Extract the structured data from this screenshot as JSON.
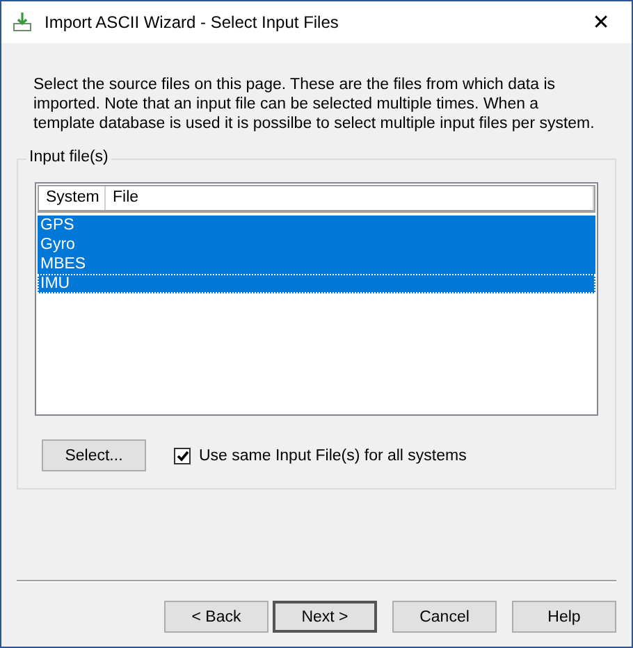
{
  "window": {
    "title": "Import ASCII Wizard - Select Input Files",
    "close": "✕"
  },
  "description": "Select the source files on this page. These are the files from which data is imported. Note that an input file can be selected multiple times. When a template database is used it is possilbe to select multiple input files per system.",
  "group": {
    "title": "Input file(s)",
    "table": {
      "columns": [
        "System",
        "File"
      ],
      "rows": [
        {
          "system": "GPS",
          "selected": true,
          "focused": false
        },
        {
          "system": "Gyro",
          "selected": true,
          "focused": false
        },
        {
          "system": "MBES",
          "selected": true,
          "focused": false
        },
        {
          "system": "IMU",
          "selected": true,
          "focused": true
        }
      ]
    },
    "select_button": "Select...",
    "checkbox": {
      "label": "Use same Input File(s) for all systems",
      "checked": true
    }
  },
  "buttons": [
    {
      "label": "< Back",
      "default": false
    },
    {
      "label": "Next >",
      "default": true
    },
    {
      "label": "Cancel",
      "default": false
    },
    {
      "label": "Help",
      "default": false
    }
  ]
}
